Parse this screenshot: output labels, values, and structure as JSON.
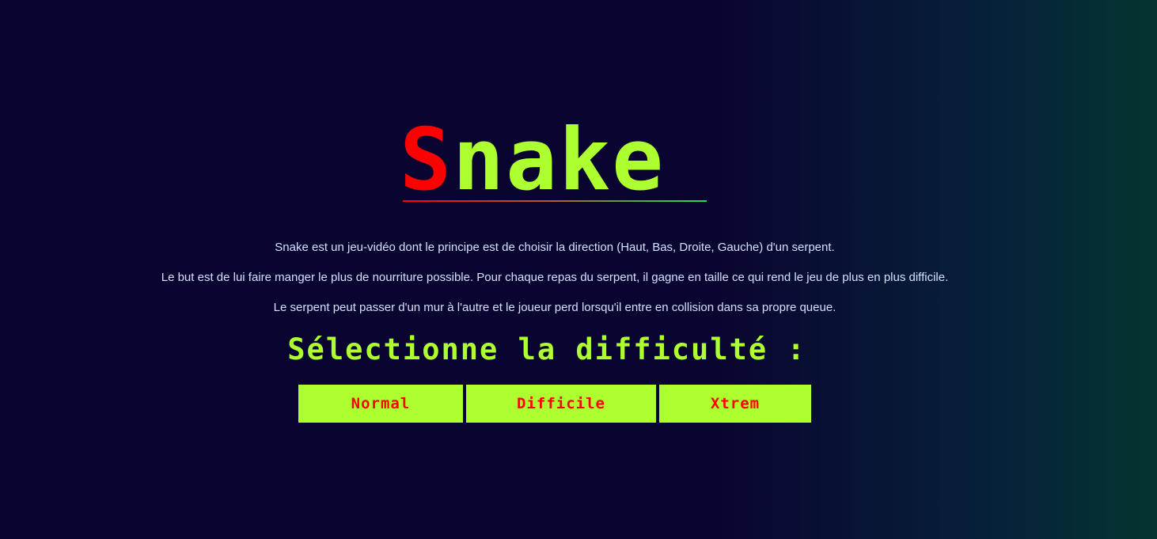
{
  "title": {
    "first_letter": "S",
    "rest": "nake"
  },
  "colors": {
    "accent": "#adff2f",
    "highlight": "#ff0000",
    "text": "#d4e0ff",
    "background": "#0a0530"
  },
  "intro": {
    "line1": "Snake est un jeu-vidéo dont le principe est de choisir la direction (Haut, Bas, Droite, Gauche) d'un serpent.",
    "line2": "Le but est de lui faire manger le plus de nourriture possible. Pour chaque repas du serpent, il gagne en taille ce qui rend le jeu de plus en plus difficile.",
    "line3": "Le serpent peut passer d'un mur à l'autre et le joueur perd lorsqu'il entre en collision dans sa propre queue."
  },
  "difficulty": {
    "heading": "Sélectionne la difficulté :",
    "options": [
      {
        "label": "Normal"
      },
      {
        "label": "Difficile"
      },
      {
        "label": "Xtrem"
      }
    ]
  }
}
